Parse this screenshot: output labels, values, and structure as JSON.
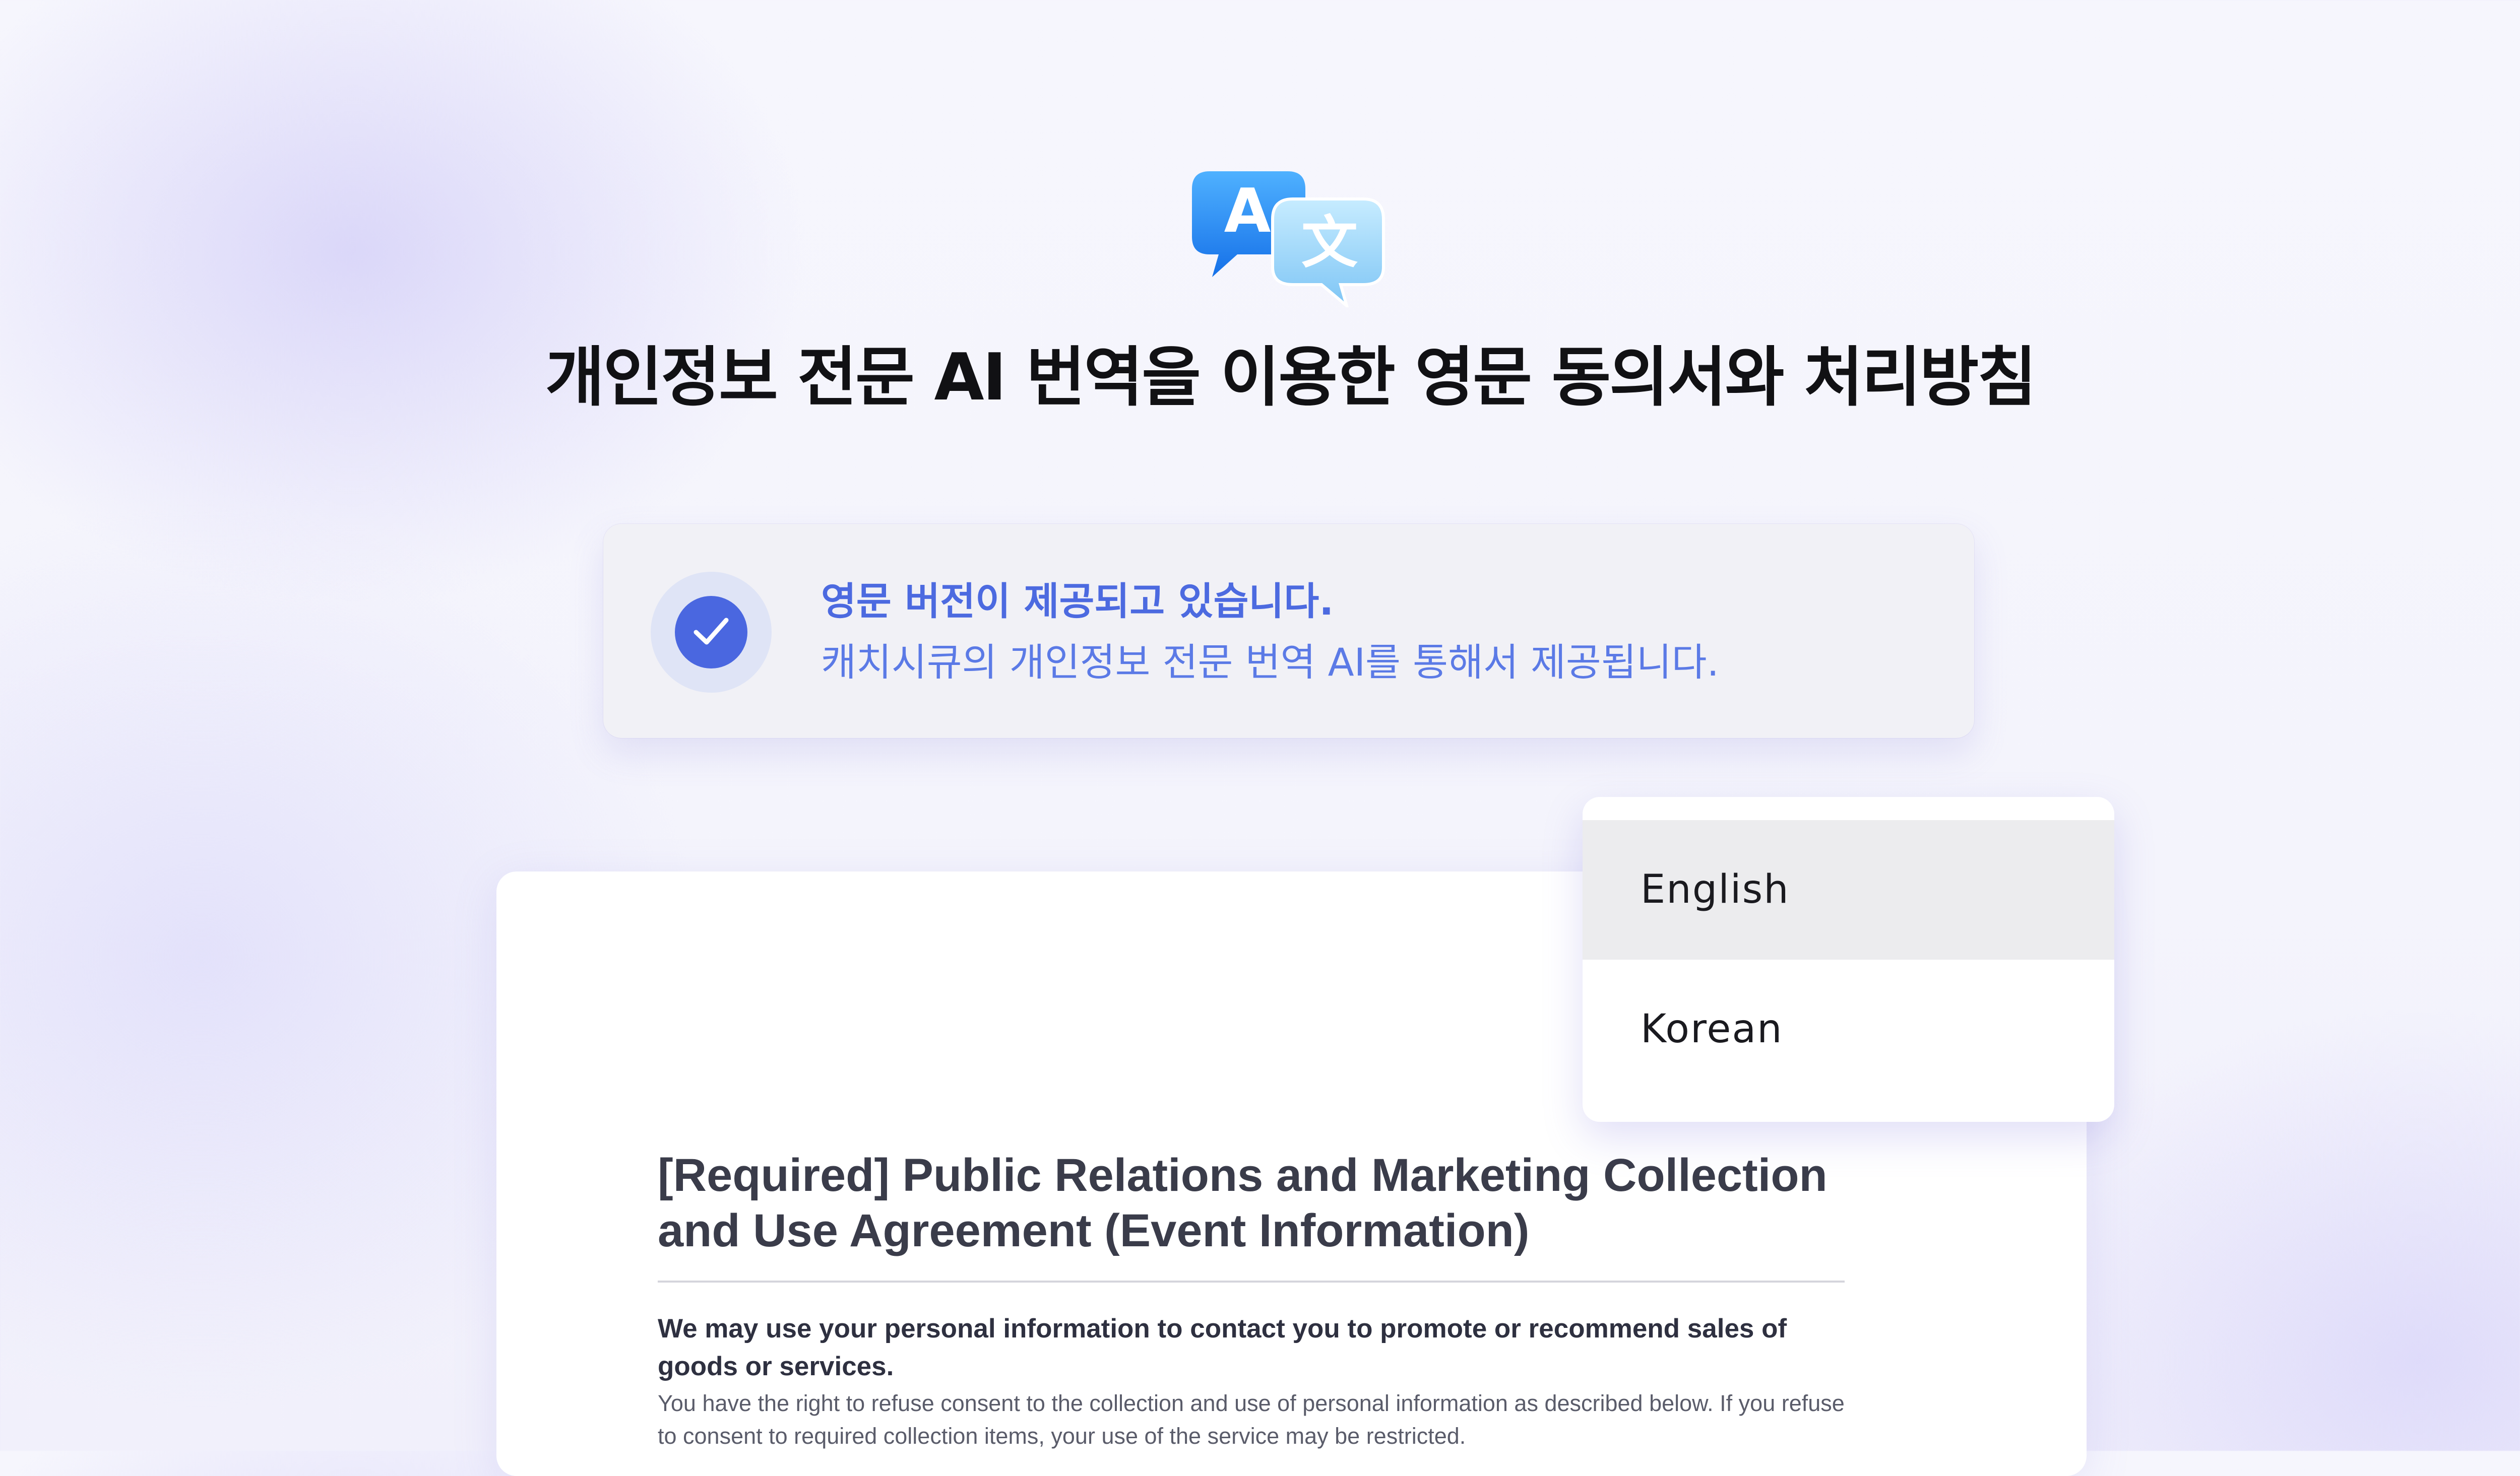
{
  "logo": {
    "icon": "translate-bubbles-icon",
    "glyph_primary": "A",
    "glyph_secondary": "文"
  },
  "headline": "개인정보 전문 AI 번역을 이용한 영문 동의서와 처리방침",
  "notice": {
    "icon": "checkmark-icon",
    "title": "영문 버전이 제공되고 있습니다.",
    "subtitle": "캐치시큐의 개인정보 전문 번역 AI를 통해서 제공됩니다."
  },
  "document": {
    "title": "[Required] Public Relations and Marketing Collection and Use Agreement (Event Information)",
    "lead": "We may use your personal information to contact you to promote or recommend sales of goods or services.",
    "body": "You have the right to refuse consent to the collection and use of personal information as described below. If you refuse to consent to required collection items, your use of the service may be restricted."
  },
  "language_menu": {
    "options": [
      "English",
      "Korean"
    ],
    "selected": "English"
  },
  "colors": {
    "accent": "#4a67e0",
    "accent_text": "#4c6ae0",
    "background": "#f4f4fc",
    "selected_item": "#ececee"
  }
}
